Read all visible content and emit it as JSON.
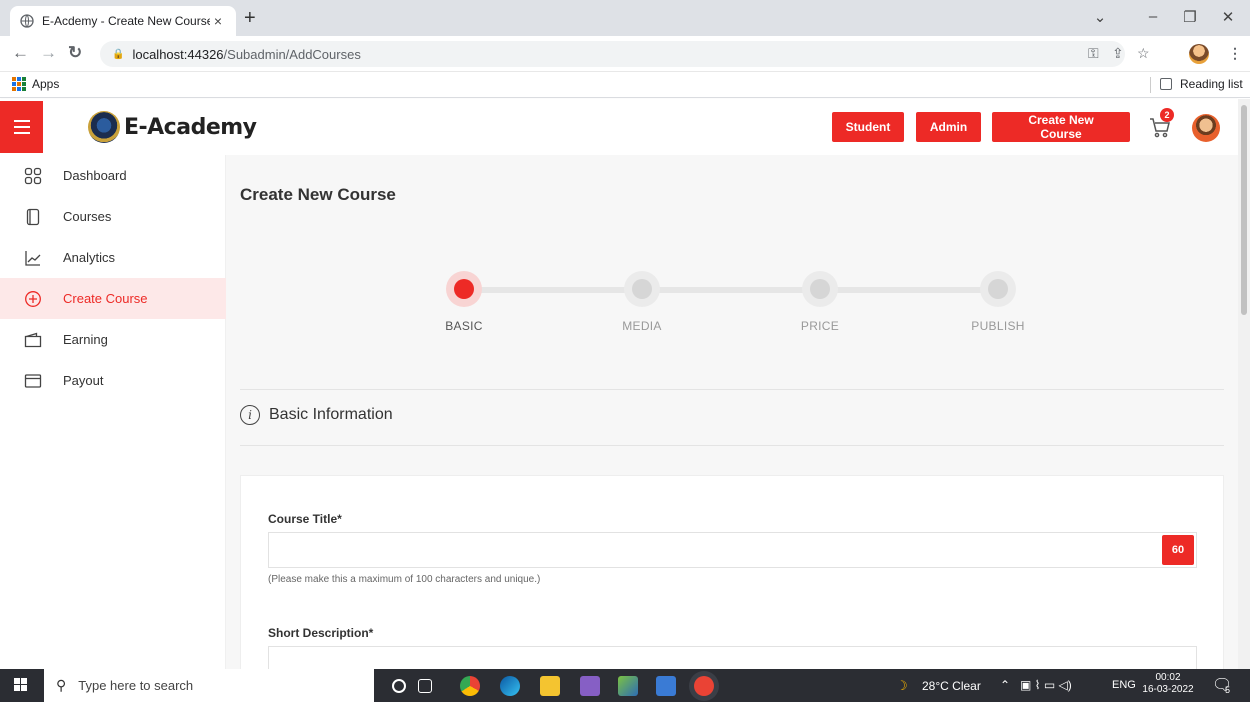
{
  "browser": {
    "tab_title": "E-Acdemy - Create New Course",
    "tab_close": "×",
    "new_tab": "+",
    "url_host": "localhost:44326",
    "url_path": "/Subadmin/AddCourses",
    "bookmarks_apps": "Apps",
    "reading_list": "Reading list",
    "controls": {
      "minimize": "–",
      "restore": "❐",
      "close": "✕",
      "dropdown": "⌄"
    }
  },
  "header": {
    "brand": "E-Academy",
    "buttons": {
      "student": "Student",
      "admin": "Admin",
      "create_course": "Create New Course"
    },
    "cart_count": "2",
    "accent_color": "#ed2a26"
  },
  "sidebar": {
    "items": [
      {
        "label": "Dashboard",
        "icon": "dashboard-grid-icon",
        "active": false
      },
      {
        "label": "Courses",
        "icon": "courses-book-icon",
        "active": false
      },
      {
        "label": "Analytics",
        "icon": "analytics-chart-icon",
        "active": false
      },
      {
        "label": "Create Course",
        "icon": "plus-circle-icon",
        "active": true
      },
      {
        "label": "Earning",
        "icon": "wallet-icon",
        "active": false
      },
      {
        "label": "Payout",
        "icon": "card-icon",
        "active": false
      }
    ]
  },
  "main": {
    "page_title": "Create New Course",
    "steps": [
      {
        "label": "BASIC",
        "active": true
      },
      {
        "label": "MEDIA",
        "active": false
      },
      {
        "label": "PRICE",
        "active": false
      },
      {
        "label": "PUBLISH",
        "active": false
      }
    ],
    "section_title": "Basic Information",
    "form": {
      "course_title_label": "Course Title*",
      "course_title_value": "",
      "course_title_counter": "60",
      "course_title_hint": "(Please make this a maximum of 100 characters and unique.)",
      "short_description_label": "Short Description*",
      "short_description_value": ""
    }
  },
  "taskbar": {
    "search_placeholder": "Type here to search",
    "weather": "28°C  Clear",
    "language": "ENG",
    "time": "00:02",
    "date": "16-03-2022",
    "notifications": "5"
  }
}
